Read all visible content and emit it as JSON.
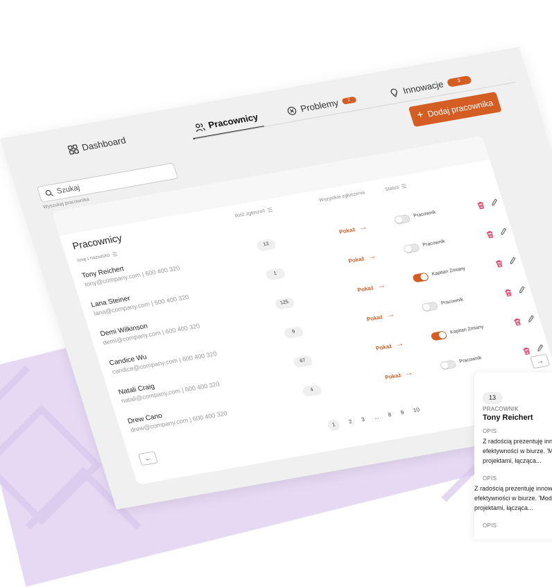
{
  "nav": {
    "dashboard": "Dashboard",
    "employees": "Pracownicy",
    "problems": "Problemy",
    "problems_badge": "2",
    "innovations": "Innowacje",
    "innovations_badge": "3"
  },
  "add_button": "Dodaj pracownika",
  "search": {
    "placeholder": "Szukaj",
    "hint": "Wyszukaj pracownika"
  },
  "table": {
    "title": "Pracownicy",
    "columns": {
      "name": "Imię i nazwisko",
      "count": "Ilość zgłoszeń",
      "all": "Wszystkie zgłoszenia",
      "status": "Status"
    },
    "rows": [
      {
        "name": "Tony Reichert",
        "contact": "tony@company.com | 600 400 320",
        "count": "13",
        "show": "Pokaż",
        "status": "Pracownik",
        "on": false
      },
      {
        "name": "Lana Steiner",
        "contact": "lana@company.com | 600 400 320",
        "count": "1",
        "show": "Pokaż",
        "status": "Pracownik",
        "on": false
      },
      {
        "name": "Demi Wilkinson",
        "contact": "demi@company.com | 600 400 320",
        "count": "125",
        "show": "Pokaż",
        "status": "Kapitan Zmiany",
        "on": true
      },
      {
        "name": "Candice Wu",
        "contact": "candice@company.com | 600 400 320",
        "count": "9",
        "show": "Pokaż",
        "status": "Pracownik",
        "on": false
      },
      {
        "name": "Natali Craig",
        "contact": "natali@company.com | 600 400 320",
        "count": "67",
        "show": "Pokaż",
        "status": "Kapitan Zmiany",
        "on": true
      },
      {
        "name": "Drew Cano",
        "contact": "drew@company.com | 600 400 320",
        "count": "4",
        "show": "Pokaż",
        "status": "Pracownik",
        "on": false
      }
    ],
    "pages": [
      "1",
      "2",
      "3",
      "...",
      "8",
      "9",
      "10"
    ]
  },
  "panel": {
    "count": "13",
    "role": "PRACOWNIK",
    "name": "Tony Reichert",
    "sections": [
      {
        "label": "OPIS",
        "line1": "Z radością prezentuję innowację",
        "line2": "efektywności w biurze. 'Moduł",
        "line3": "projektami, łącząca..."
      },
      {
        "label": "OPIS",
        "line1": "Z radością prezentuję innowację",
        "line2": "efektywności w biurze. 'Moduł",
        "line3": "projektami, łącząca..."
      },
      {
        "label": "OPIS"
      }
    ]
  },
  "colors": {
    "accent": "#d35d23",
    "purple": "#e5d9f3"
  }
}
